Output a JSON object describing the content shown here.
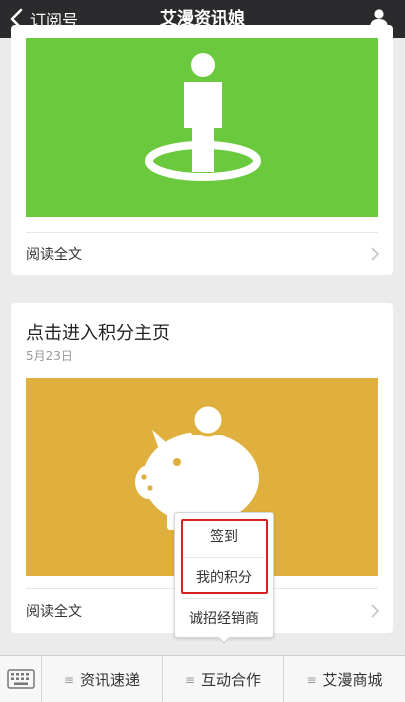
{
  "header": {
    "back_label": "订阅号",
    "title": "艾漫资讯娘",
    "icons": {
      "back": "chevron-left-icon",
      "profile": "user-icon"
    }
  },
  "articles": [
    {
      "cover_icon": "person-on-location-icon",
      "cover_color": "#6ac93c",
      "read_more": "阅读全文"
    },
    {
      "title": "点击进入积分主页",
      "date": "5月23日",
      "cover_icon": "piggy-bank-icon",
      "cover_color": "#dfb03d",
      "read_more": "阅读全文"
    }
  ],
  "popup_menu": {
    "items": [
      "签到",
      "我的积分",
      "诚招经销商"
    ],
    "highlight_color": "#d22424"
  },
  "bottom_bar": {
    "keyboard_icon": "keyboard-icon",
    "tabs": [
      {
        "label": "资讯速递"
      },
      {
        "label": "互动合作"
      },
      {
        "label": "艾漫商城"
      }
    ],
    "tab_icon": "menu-icon"
  }
}
